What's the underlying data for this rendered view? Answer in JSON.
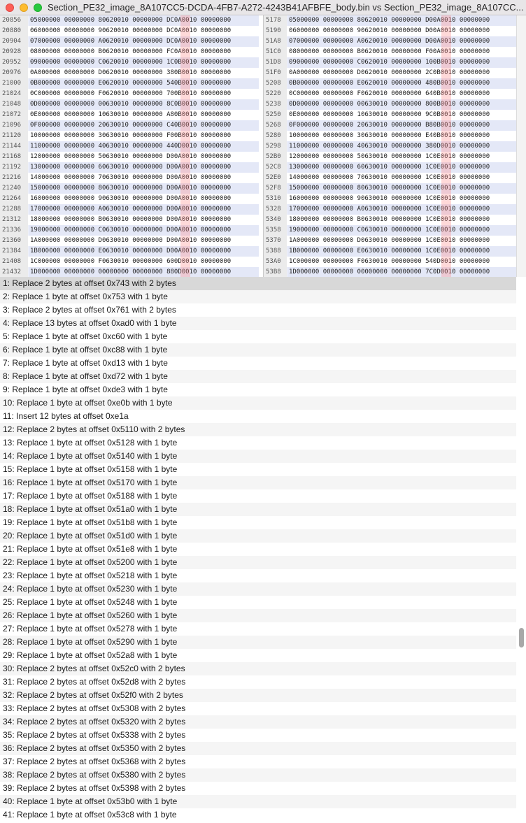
{
  "window": {
    "title": "Section_PE32_image_8A107CC5-DCDA-4FB7-A272-4243B41AFBFE_body.bin vs Section_PE32_image_8A107CC..."
  },
  "left_hex": [
    {
      "offset": "20856",
      "data": "05000000 00000000 80620010 00000000 DC0A0010 00000000"
    },
    {
      "offset": "20880",
      "data": "06000000 00000000 90620010 00000000 DC0A0010 00000000"
    },
    {
      "offset": "20904",
      "data": "07000000 00000000 A0620010 00000000 DC0A0010 00000000"
    },
    {
      "offset": "20928",
      "data": "08000000 00000000 B0620010 00000000 FC0A0010 00000000"
    },
    {
      "offset": "20952",
      "data": "09000000 00000000 C0620010 00000000 1C0B0010 00000000"
    },
    {
      "offset": "20976",
      "data": "0A000000 00000000 D0620010 00000000 380B0010 00000000"
    },
    {
      "offset": "21000",
      "data": "0B000000 00000000 E0620010 00000000 540B0010 00000000"
    },
    {
      "offset": "21024",
      "data": "0C000000 00000000 F0620010 00000000 700B0010 00000000"
    },
    {
      "offset": "21048",
      "data": "0D000000 00000000 00630010 00000000 8C0B0010 00000000"
    },
    {
      "offset": "21072",
      "data": "0E000000 00000000 10630010 00000000 A80B0010 00000000"
    },
    {
      "offset": "21096",
      "data": "0F000000 00000000 20630010 00000000 C40B0010 00000000"
    },
    {
      "offset": "21120",
      "data": "10000000 00000000 30630010 00000000 F00B0010 00000000"
    },
    {
      "offset": "21144",
      "data": "11000000 00000000 40630010 00000000 440D0010 00000000"
    },
    {
      "offset": "21168",
      "data": "12000000 00000000 50630010 00000000 D00A0010 00000000"
    },
    {
      "offset": "21192",
      "data": "13000000 00000000 60630010 00000000 D00A0010 00000000"
    },
    {
      "offset": "21216",
      "data": "14000000 00000000 70630010 00000000 D00A0010 00000000"
    },
    {
      "offset": "21240",
      "data": "15000000 00000000 80630010 00000000 D00A0010 00000000"
    },
    {
      "offset": "21264",
      "data": "16000000 00000000 90630010 00000000 D00A0010 00000000"
    },
    {
      "offset": "21288",
      "data": "17000000 00000000 A0630010 00000000 D00A0010 00000000"
    },
    {
      "offset": "21312",
      "data": "18000000 00000000 B0630010 00000000 D00A0010 00000000"
    },
    {
      "offset": "21336",
      "data": "19000000 00000000 C0630010 00000000 D00A0010 00000000"
    },
    {
      "offset": "21360",
      "data": "1A000000 00000000 D0630010 00000000 D00A0010 00000000"
    },
    {
      "offset": "21384",
      "data": "1B000000 00000000 E0630010 00000000 D00A0010 00000000"
    },
    {
      "offset": "21408",
      "data": "1C000000 00000000 F0630010 00000000 600D0010 00000000"
    },
    {
      "offset": "21432",
      "data": "1D000000 00000000 00000000 00000000 880D0010 00000000"
    }
  ],
  "right_hex": [
    {
      "offset": "5178",
      "data": "05000000 00000000 80620010 00000000 D00A0010 00000000"
    },
    {
      "offset": "5190",
      "data": "06000000 00000000 90620010 00000000 D00A0010 00000000"
    },
    {
      "offset": "51A8",
      "data": "07000000 00000000 A0620010 00000000 D00A0010 00000000"
    },
    {
      "offset": "51C0",
      "data": "08000000 00000000 B0620010 00000000 F00A0010 00000000"
    },
    {
      "offset": "51D8",
      "data": "09000000 00000000 C0620010 00000000 100B0010 00000000"
    },
    {
      "offset": "51F0",
      "data": "0A000000 00000000 D0620010 00000000 2C0B0010 00000000"
    },
    {
      "offset": "5208",
      "data": "0B000000 00000000 E0620010 00000000 480B0010 00000000"
    },
    {
      "offset": "5220",
      "data": "0C000000 00000000 F0620010 00000000 640B0010 00000000"
    },
    {
      "offset": "5238",
      "data": "0D000000 00000000 00630010 00000000 800B0010 00000000"
    },
    {
      "offset": "5250",
      "data": "0E000000 00000000 10630010 00000000 9C0B0010 00000000"
    },
    {
      "offset": "5268",
      "data": "0F000000 00000000 20630010 00000000 B80B0010 00000000"
    },
    {
      "offset": "5280",
      "data": "10000000 00000000 30630010 00000000 E40B0010 00000000"
    },
    {
      "offset": "5298",
      "data": "11000000 00000000 40630010 00000000 380D0010 00000000"
    },
    {
      "offset": "52B0",
      "data": "12000000 00000000 50630010 00000000 1C0E0010 00000000"
    },
    {
      "offset": "52C8",
      "data": "13000000 00000000 60630010 00000000 1C0E0010 00000000"
    },
    {
      "offset": "52E0",
      "data": "14000000 00000000 70630010 00000000 1C0E0010 00000000"
    },
    {
      "offset": "52F8",
      "data": "15000000 00000000 80630010 00000000 1C0E0010 00000000"
    },
    {
      "offset": "5310",
      "data": "16000000 00000000 90630010 00000000 1C0E0010 00000000"
    },
    {
      "offset": "5328",
      "data": "17000000 00000000 A0630010 00000000 1C0E0010 00000000"
    },
    {
      "offset": "5340",
      "data": "18000000 00000000 B0630010 00000000 1C0E0010 00000000"
    },
    {
      "offset": "5358",
      "data": "19000000 00000000 C0630010 00000000 1C0E0010 00000000"
    },
    {
      "offset": "5370",
      "data": "1A000000 00000000 D0630010 00000000 1C0E0010 00000000"
    },
    {
      "offset": "5388",
      "data": "1B000000 00000000 E0630010 00000000 1C0E0010 00000000"
    },
    {
      "offset": "53A0",
      "data": "1C000000 00000000 F0630010 00000000 540D0010 00000000"
    },
    {
      "offset": "53B8",
      "data": "1D000000 00000000 00000000 00000000 7C0D0010 00000000"
    }
  ],
  "differences": [
    "1: Replace 2 bytes at offset 0x743 with 2 bytes",
    "2: Replace 1 byte at offset 0x753 with 1 byte",
    "3: Replace 2 bytes at offset 0x761 with 2 bytes",
    "4: Replace 13 bytes at offset 0xad0 with 1 byte",
    "5: Replace 1 byte at offset 0xc60 with 1 byte",
    "6: Replace 1 byte at offset 0xc88 with 1 byte",
    "7: Replace 1 byte at offset 0xd13 with 1 byte",
    "8: Replace 1 byte at offset 0xd72 with 1 byte",
    "9: Replace 1 byte at offset 0xde3 with 1 byte",
    "10: Replace 1 byte at offset 0xe0b with 1 byte",
    "11: Insert 12 bytes at offset 0xe1a",
    "12: Replace 2 bytes at offset 0x5110 with 2 bytes",
    "13: Replace 1 byte at offset 0x5128 with 1 byte",
    "14: Replace 1 byte at offset 0x5140 with 1 byte",
    "15: Replace 1 byte at offset 0x5158 with 1 byte",
    "16: Replace 1 byte at offset 0x5170 with 1 byte",
    "17: Replace 1 byte at offset 0x5188 with 1 byte",
    "18: Replace 1 byte at offset 0x51a0 with 1 byte",
    "19: Replace 1 byte at offset 0x51b8 with 1 byte",
    "20: Replace 1 byte at offset 0x51d0 with 1 byte",
    "21: Replace 1 byte at offset 0x51e8 with 1 byte",
    "22: Replace 1 byte at offset 0x5200 with 1 byte",
    "23: Replace 1 byte at offset 0x5218 with 1 byte",
    "24: Replace 1 byte at offset 0x5230 with 1 byte",
    "25: Replace 1 byte at offset 0x5248 with 1 byte",
    "26: Replace 1 byte at offset 0x5260 with 1 byte",
    "27: Replace 1 byte at offset 0x5278 with 1 byte",
    "28: Replace 1 byte at offset 0x5290 with 1 byte",
    "29: Replace 1 byte at offset 0x52a8 with 1 byte",
    "30: Replace 2 bytes at offset 0x52c0 with 2 bytes",
    "31: Replace 2 bytes at offset 0x52d8 with 2 bytes",
    "32: Replace 2 bytes at offset 0x52f0 with 2 bytes",
    "33: Replace 2 bytes at offset 0x5308 with 2 bytes",
    "34: Replace 2 bytes at offset 0x5320 with 2 bytes",
    "35: Replace 2 bytes at offset 0x5338 with 2 bytes",
    "36: Replace 2 bytes at offset 0x5350 with 2 bytes",
    "37: Replace 2 bytes at offset 0x5368 with 2 bytes",
    "38: Replace 2 bytes at offset 0x5380 with 2 bytes",
    "39: Replace 2 bytes at offset 0x5398 with 2 bytes",
    "40: Replace 1 byte at offset 0x53b0 with 1 byte",
    "41: Replace 1 byte at offset 0x53c8 with 1 byte"
  ],
  "selected_difference": 0,
  "colors": {
    "diff_highlight": "#ffb0b0",
    "row_band": "#eef0f9",
    "selection": "#d8d8d8"
  }
}
